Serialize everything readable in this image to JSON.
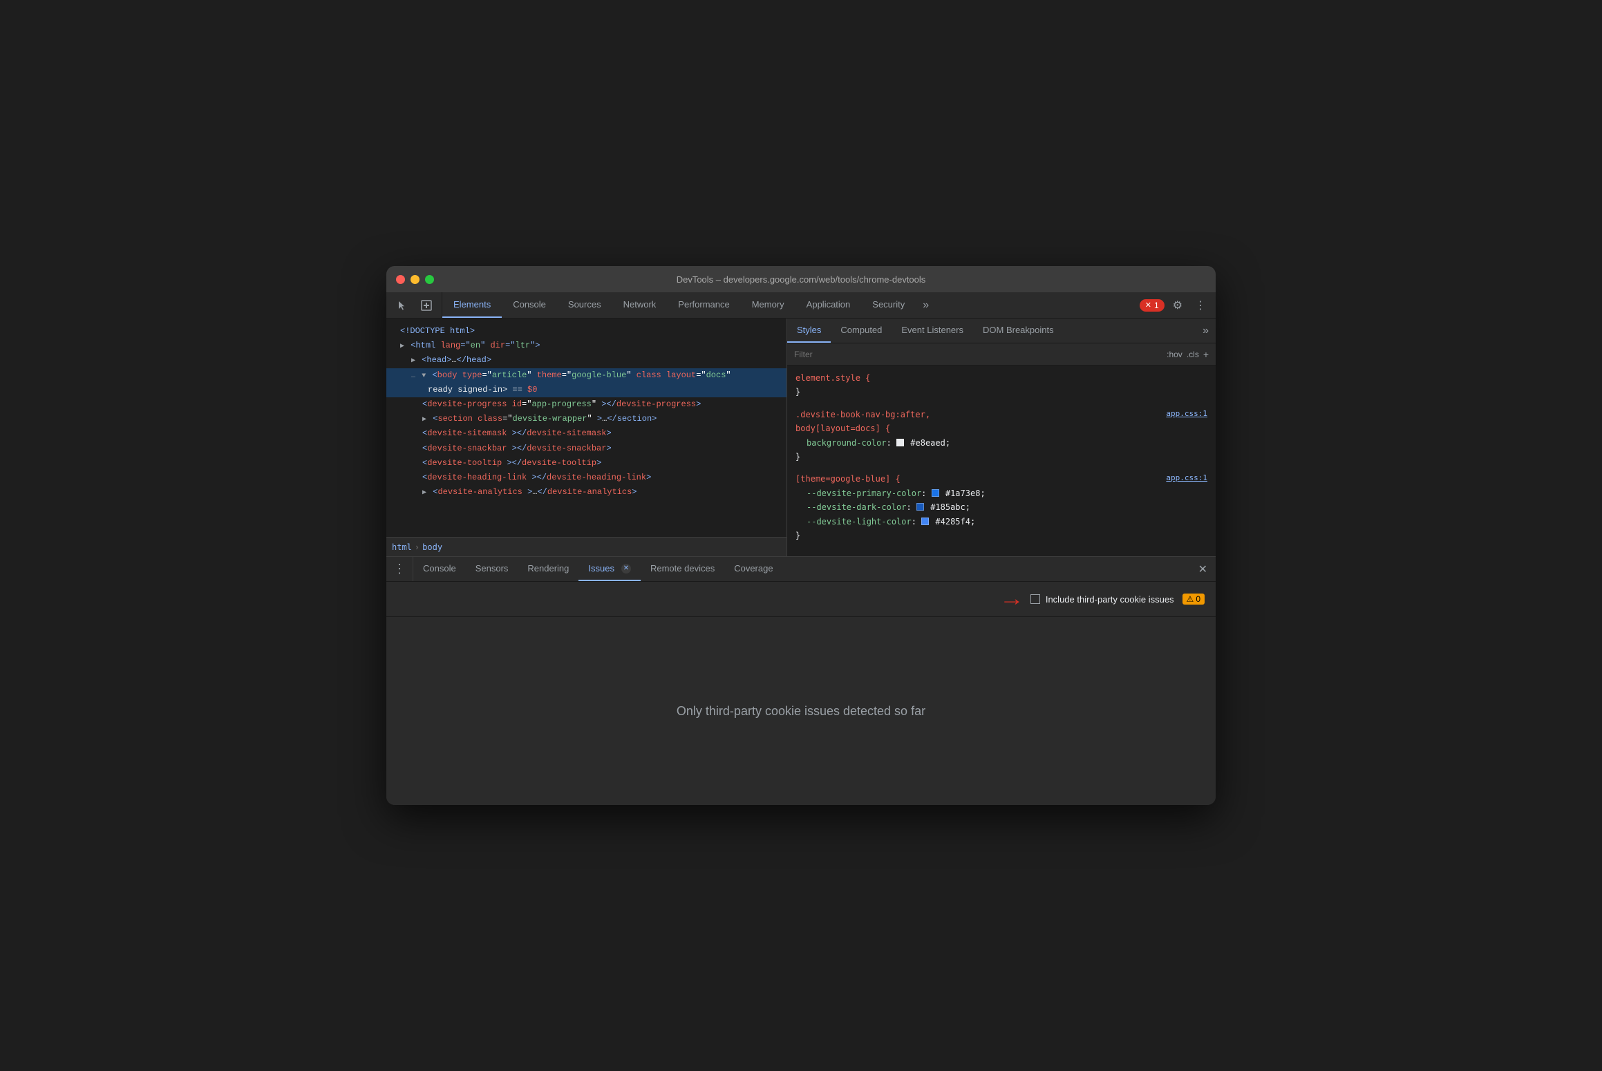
{
  "window": {
    "title": "DevTools – developers.google.com/web/tools/chrome-devtools"
  },
  "devtools": {
    "tabs": [
      {
        "label": "Elements",
        "active": true
      },
      {
        "label": "Console",
        "active": false
      },
      {
        "label": "Sources",
        "active": false
      },
      {
        "label": "Network",
        "active": false
      },
      {
        "label": "Performance",
        "active": false
      },
      {
        "label": "Memory",
        "active": false
      },
      {
        "label": "Application",
        "active": false
      },
      {
        "label": "Security",
        "active": false
      }
    ],
    "more_tabs": "»",
    "error_count": "1",
    "settings_label": "⚙",
    "more_menu": "⋮"
  },
  "dom": {
    "lines": [
      {
        "indent": 0,
        "content": "<!DOCTYPE html>",
        "type": "doctype"
      },
      {
        "indent": 0,
        "content": "<html lang=\"en\" dir=\"ltr\">",
        "type": "open-tag"
      },
      {
        "indent": 1,
        "content": "▶ <head>…</head>",
        "type": "collapsed"
      },
      {
        "indent": 1,
        "content": "<body type=\"article\" theme=\"google-blue\" class layout=\"docs\"",
        "type": "selected-open",
        "selected": true
      },
      {
        "indent": 2,
        "content": "ready signed-in> == $0",
        "type": "selected-cont",
        "selected": true
      },
      {
        "indent": 2,
        "content": "<devsite-progress id=\"app-progress\"></devsite-progress>",
        "type": "element"
      },
      {
        "indent": 2,
        "content": "▶ <section class=\"devsite-wrapper\">…</section>",
        "type": "collapsed"
      },
      {
        "indent": 2,
        "content": "<devsite-sitemask></devsite-sitemask>",
        "type": "element"
      },
      {
        "indent": 2,
        "content": "<devsite-snackbar></devsite-snackbar>",
        "type": "element"
      },
      {
        "indent": 2,
        "content": "<devsite-tooltip></devsite-tooltip>",
        "type": "element"
      },
      {
        "indent": 2,
        "content": "<devsite-heading-link></devsite-heading-link>",
        "type": "element"
      },
      {
        "indent": 2,
        "content": "▶ <devsite-analytics>…</devsite-analytics>",
        "type": "collapsed"
      }
    ]
  },
  "breadcrumb": {
    "items": [
      "html",
      "body"
    ]
  },
  "styles_panel": {
    "tabs": [
      {
        "label": "Styles",
        "active": true
      },
      {
        "label": "Computed",
        "active": false
      },
      {
        "label": "Event Listeners",
        "active": false
      },
      {
        "label": "DOM Breakpoints",
        "active": false
      }
    ],
    "filter_placeholder": "Filter",
    "filter_hov": ":hov",
    "filter_cls": ".cls",
    "filter_plus": "+",
    "rules": [
      {
        "selector": "element.style {",
        "source": "",
        "props": [],
        "close": "}"
      },
      {
        "selector": ".devsite-book-nav-bg:after,\nbody[layout=docs] {",
        "source": "app.css:1",
        "props": [
          {
            "name": "background-color:",
            "value": "#e8eaed",
            "swatch": "#e8eaed"
          }
        ],
        "close": "}"
      },
      {
        "selector": "[theme=google-blue] {",
        "source": "app.css:1",
        "props": [
          {
            "name": "--devsite-primary-color:",
            "value": "#1a73e8",
            "swatch": "#1a73e8"
          },
          {
            "name": "--devsite-dark-color:",
            "value": "#185abc",
            "swatch": "#185abc"
          },
          {
            "name": "--devsite-light-color:",
            "value": "#4285f4",
            "swatch": "#4285f4"
          }
        ],
        "close": "}"
      }
    ]
  },
  "drawer": {
    "tabs": [
      {
        "label": "Console",
        "active": false
      },
      {
        "label": "Sensors",
        "active": false
      },
      {
        "label": "Rendering",
        "active": false
      },
      {
        "label": "Issues",
        "active": true,
        "closeable": true
      },
      {
        "label": "Remote devices",
        "active": false
      },
      {
        "label": "Coverage",
        "active": false
      }
    ],
    "issues": {
      "checkbox_label": "Include third-party cookie issues",
      "warning_count": "0",
      "empty_message": "Only third-party cookie issues detected so far"
    }
  }
}
